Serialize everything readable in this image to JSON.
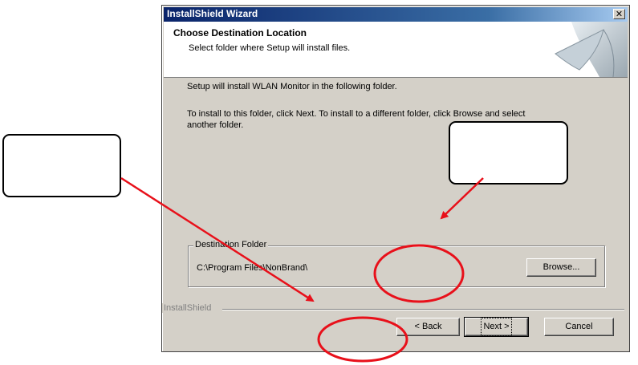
{
  "window": {
    "title": "InstallShield Wizard",
    "close_glyph": "✕"
  },
  "header": {
    "title": "Choose Destination Location",
    "subtitle": "Select folder where Setup will install files."
  },
  "body": {
    "line1": "Setup will install WLAN Monitor in the following folder.",
    "line2": "To install to this folder, click Next. To install to a different folder, click Browse and select",
    "line3": "another folder."
  },
  "destination": {
    "legend": "Destination Folder",
    "path": "C:\\Program Files\\NonBrand\\",
    "browse_label": "Browse..."
  },
  "footer": {
    "brand": "InstallShield",
    "back_label": "< Back",
    "next_label": "Next >",
    "cancel_label": "Cancel"
  },
  "annotations": {
    "arrow_color": "#e8101a",
    "ellipse_color": "#e8101a"
  }
}
